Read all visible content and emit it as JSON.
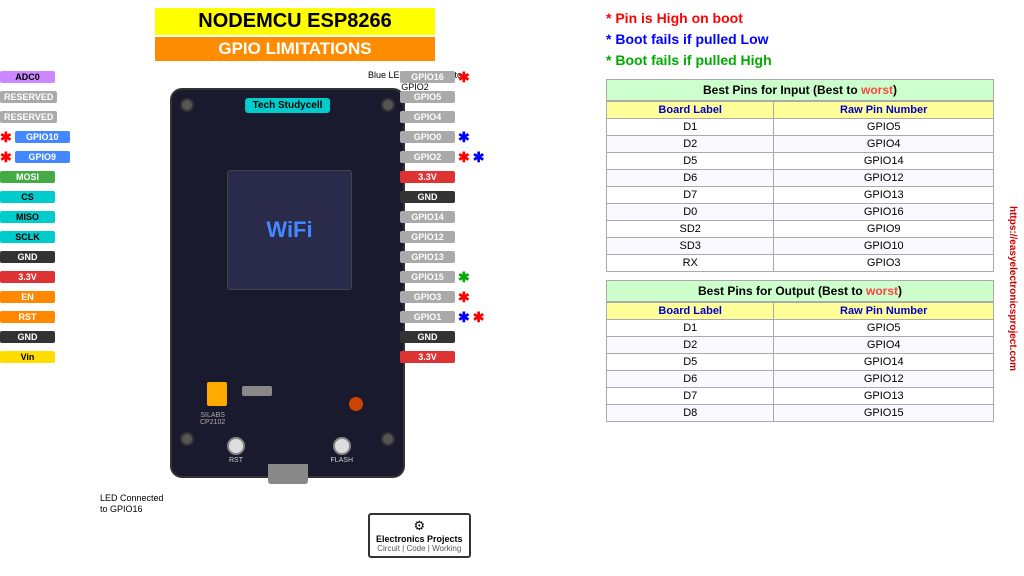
{
  "title": {
    "line1": "NODEMCU  ESP8266",
    "line2": "GPIO LIMITATIONS"
  },
  "legend": {
    "item1": "* Pin is High on boot",
    "item2": "* Boot fails if pulled Low",
    "item3": "* Boot fails if pulled High"
  },
  "board": {
    "tech_label": "Tech Studycell",
    "blue_led_note": "Blue LED Connected to\nGPIO2",
    "gpio16_note": "LED Connected\nto GPIO16",
    "logo_title": "Electronics Projects",
    "logo_sub": "Circuit | Code | Working"
  },
  "pins_right": [
    {
      "label": "GPIO16",
      "star": "red"
    },
    {
      "label": "GPIO5",
      "star": ""
    },
    {
      "label": "GPIO4",
      "star": ""
    },
    {
      "label": "GPIO0",
      "star": "blue"
    },
    {
      "label": "GPIO2",
      "star": "red-blue"
    },
    {
      "label": "3.3V",
      "star": ""
    },
    {
      "label": "GND",
      "star": ""
    },
    {
      "label": "GPIO14",
      "star": ""
    },
    {
      "label": "GPIO12",
      "star": ""
    },
    {
      "label": "GPIO13",
      "star": ""
    },
    {
      "label": "GPIO15",
      "star": "green"
    },
    {
      "label": "GPIO3",
      "star": "red"
    },
    {
      "label": "GPIO1",
      "star": "blue-red"
    },
    {
      "label": "GND",
      "star": ""
    },
    {
      "label": "3.3V",
      "star": ""
    }
  ],
  "pins_left": [
    {
      "label": "ADC0",
      "class": "pin-purple"
    },
    {
      "label": "RESERVED",
      "class": "pin-gray"
    },
    {
      "label": "RESERVED",
      "class": "pin-gray"
    },
    {
      "label": "GPIO10",
      "class": "pin-blue"
    },
    {
      "label": "GPIO9",
      "class": "pin-blue"
    },
    {
      "label": "MOSI",
      "class": "pin-green"
    },
    {
      "label": "CS",
      "class": "pin-cyan"
    },
    {
      "label": "MISO",
      "class": "pin-cyan"
    },
    {
      "label": "SCLK",
      "class": "pin-cyan"
    },
    {
      "label": "GND",
      "class": "pin-black"
    },
    {
      "label": "3.3V",
      "class": "pin-red"
    },
    {
      "label": "EN",
      "class": "pin-orange"
    },
    {
      "label": "RST",
      "class": "pin-orange"
    },
    {
      "label": "GND",
      "class": "pin-black"
    },
    {
      "label": "Vin",
      "class": "pin-yellow"
    }
  ],
  "input_table": {
    "title": "Best Pins for Input (Best to worst)",
    "headers": [
      "Board Label",
      "Raw Pin Number"
    ],
    "rows": [
      [
        "D1",
        "GPIO5"
      ],
      [
        "D2",
        "GPIO4"
      ],
      [
        "D5",
        "GPIO14"
      ],
      [
        "D6",
        "GPIO12"
      ],
      [
        "D7",
        "GPIO13"
      ],
      [
        "D0",
        "GPIO16"
      ],
      [
        "SD2",
        "GPIO9"
      ],
      [
        "SD3",
        "GPIO10"
      ],
      [
        "RX",
        "GPIO3"
      ]
    ]
  },
  "output_table": {
    "title": "Best Pins for Output (Best to worst)",
    "headers": [
      "Board Label",
      "Raw Pin Number"
    ],
    "rows": [
      [
        "D1",
        "GPIO5"
      ],
      [
        "D2",
        "GPIO4"
      ],
      [
        "D5",
        "GPIO14"
      ],
      [
        "D6",
        "GPIO12"
      ],
      [
        "D7",
        "GPIO13"
      ],
      [
        "D8",
        "GPIO15"
      ]
    ]
  },
  "vertical_text": "https://easyelectronicsproject.com"
}
